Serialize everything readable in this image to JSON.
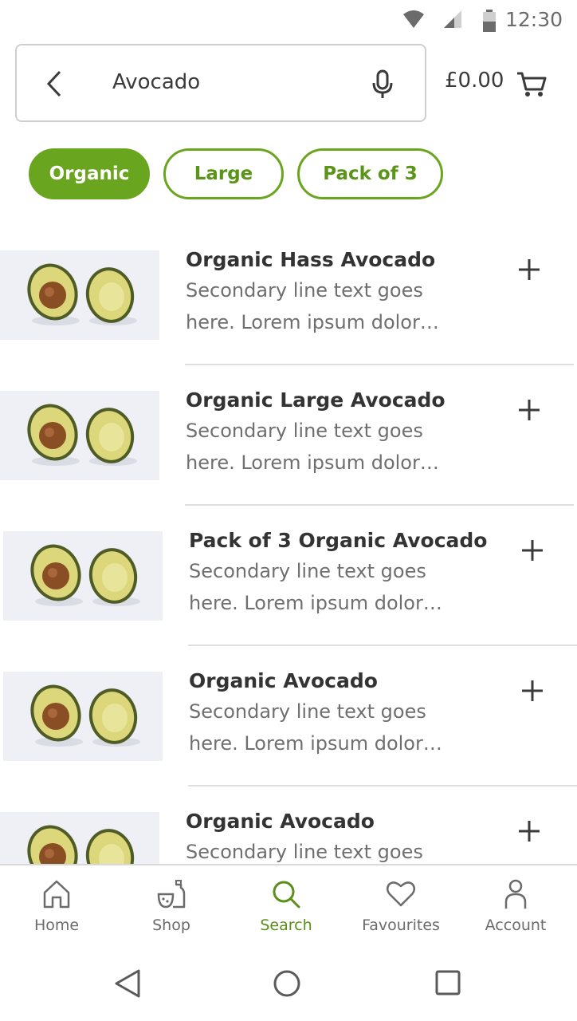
{
  "status_bar": {
    "time": "12:30",
    "icons": [
      "wifi-icon",
      "signal-icon",
      "battery-icon"
    ]
  },
  "search": {
    "value": "Avocado",
    "placeholder": "",
    "back_icon": "chevron-left-icon",
    "mic_icon": "microphone-icon"
  },
  "cart": {
    "total": "£0.00",
    "icon": "cart-icon"
  },
  "chips": [
    {
      "label": "Organic",
      "selected": true
    },
    {
      "label": "Large",
      "selected": false
    },
    {
      "label": "Pack of 3",
      "selected": false
    }
  ],
  "products": [
    {
      "title": "Organic Hass Avocado",
      "desc_line1": "Secondary line text goes",
      "desc_line2": "here. Lorem ipsum dolor…"
    },
    {
      "title": "Organic Large Avocado",
      "desc_line1": "Secondary line text goes",
      "desc_line2": "here. Lorem ipsum dolor…"
    },
    {
      "title": "Pack of 3 Organic Avocado",
      "desc_line1": "Secondary line text goes",
      "desc_line2": "here. Lorem ipsum dolor…"
    },
    {
      "title": "Organic Avocado",
      "desc_line1": "Secondary line text goes",
      "desc_line2": "here. Lorem ipsum dolor…"
    },
    {
      "title": "Organic Avocado",
      "desc_line1": "Secondary line text goes",
      "desc_line2": ""
    }
  ],
  "bottom_nav": [
    {
      "label": "Home",
      "icon": "home-icon",
      "active": false
    },
    {
      "label": "Shop",
      "icon": "shop-icon",
      "active": false
    },
    {
      "label": "Search",
      "icon": "search-icon",
      "active": true
    },
    {
      "label": "Favourites",
      "icon": "heart-icon",
      "active": false
    },
    {
      "label": "Account",
      "icon": "person-icon",
      "active": false
    }
  ],
  "colors": {
    "accent": "#6aa51f",
    "text": "#333333",
    "secondary_text": "#6f6f6f",
    "divider": "#dedede"
  }
}
